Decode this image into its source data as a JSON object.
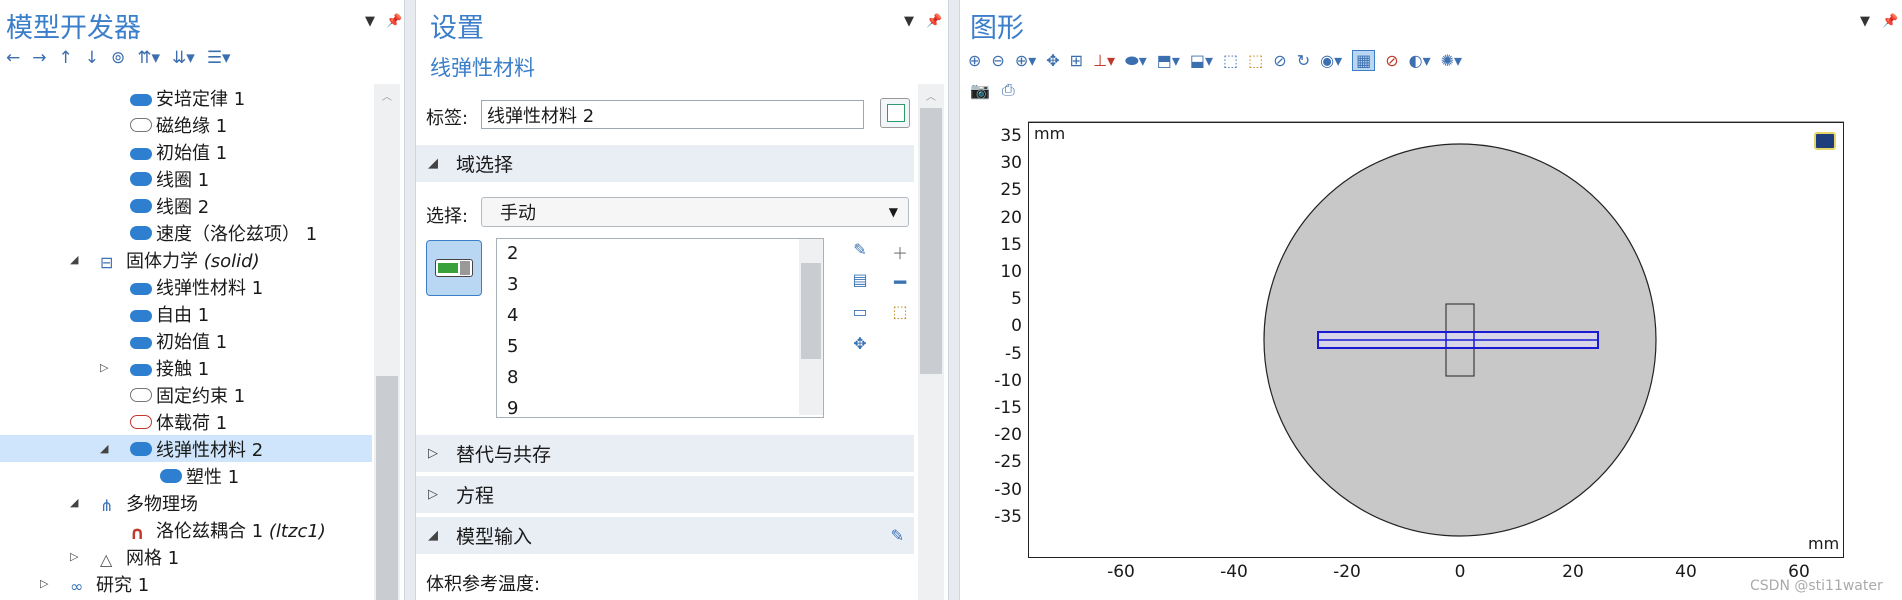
{
  "model_builder": {
    "title": "模型开发器",
    "tree": [
      {
        "label": "安培定律 1",
        "icon": "d-icon",
        "indent": 1
      },
      {
        "label": "磁绝缘 1",
        "icon": "boundary-pill-icon",
        "indent": 1
      },
      {
        "label": "初始值 1",
        "icon": "d-icon",
        "indent": 1
      },
      {
        "label": "线圈 1",
        "icon": "domain-blob-icon",
        "indent": 1
      },
      {
        "label": "线圈 2",
        "icon": "domain-blob-icon",
        "indent": 1
      },
      {
        "label": "速度（洛伦兹项） 1",
        "icon": "domain-blob-icon",
        "indent": 1
      },
      {
        "label": "固体力学",
        "suffix": "(solid)",
        "icon": "solid-mechanics-icon",
        "indent": 0,
        "expanded": true
      },
      {
        "label": "线弹性材料 1",
        "icon": "d-icon",
        "indent": 1
      },
      {
        "label": "自由 1",
        "icon": "d-icon",
        "indent": 1
      },
      {
        "label": "初始值 1",
        "icon": "d-icon",
        "indent": 1
      },
      {
        "label": "接触 1",
        "icon": "d-icon",
        "indent": 1,
        "collapsed": true
      },
      {
        "label": "固定约束 1",
        "icon": "boundary-pill-icon",
        "indent": 1
      },
      {
        "label": "体载荷 1",
        "icon": "body-load-icon",
        "indent": 1
      },
      {
        "label": "线弹性材料 2",
        "icon": "domain-blob-icon",
        "indent": 1,
        "expanded": true,
        "selected": true
      },
      {
        "label": "塑性 1",
        "icon": "domain-blob-icon",
        "indent": 2
      },
      {
        "label": "多物理场",
        "icon": "multiphysics-icon",
        "indent": 0,
        "expanded": true
      },
      {
        "label": "洛伦兹耦合 1",
        "suffix": "(ltzc1)",
        "icon": "magnet-icon",
        "indent": 1
      },
      {
        "label": "网格 1",
        "icon": "mesh-icon",
        "indent": 0,
        "collapsed": true
      },
      {
        "label": "研究 1",
        "icon": "study-icon",
        "indent": -1,
        "collapsed": true
      }
    ]
  },
  "settings": {
    "title": "设置",
    "subtitle": "线弹性材料",
    "label_caption": "标签:",
    "label_value": "线弹性材料 2",
    "section_domain": "域选择",
    "selection_caption": "选择:",
    "selection_value": "手动",
    "selection_items": [
      "2",
      "3",
      "4",
      "5",
      "8",
      "9"
    ],
    "section_override": "替代与共存",
    "section_equation": "方程",
    "section_model_input": "模型输入",
    "volume_ref_temp": "体积参考温度:"
  },
  "graphics": {
    "title": "图形",
    "unit_top": "mm",
    "unit_bottom": "mm",
    "y_ticks": [
      "35",
      "30",
      "25",
      "20",
      "15",
      "10",
      "5",
      "0",
      "-5",
      "-10",
      "-15",
      "-20",
      "-25",
      "-30",
      "-35"
    ],
    "x_ticks": [
      "-60",
      "-40",
      "-20",
      "0",
      "20",
      "40",
      "60"
    ],
    "watermark": "CSDN @sti11water",
    "colors": {
      "accent": "#3b7ec9",
      "selected_domain": "#1a1ad6",
      "geometry_fill": "#c8c8c8"
    }
  }
}
